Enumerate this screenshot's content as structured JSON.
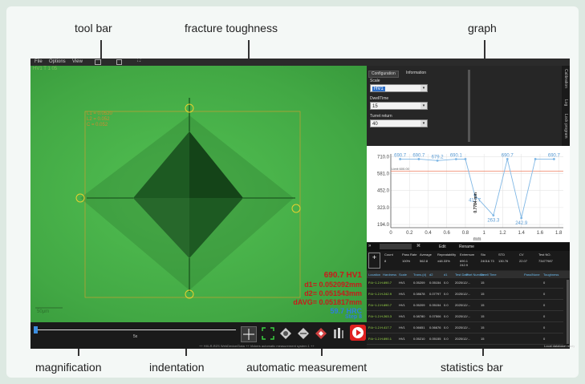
{
  "callouts": {
    "tool_bar": "tool bar",
    "fracture_toughness": "fracture toughness",
    "graph": "graph",
    "magnification": "magnification",
    "indentation": "indentation",
    "automatic_measurement": "automatic measurement",
    "statistics_bar": "statistics bar"
  },
  "menu": {
    "file": "File",
    "options": "Options",
    "view": "View"
  },
  "viewer": {
    "top_left_note": "HV1 T 1 05",
    "overlay_l1": "L1 = 0.0520",
    "overlay_l2": "L2 = 0.052",
    "overlay_l3": "C = 0.052",
    "scale_label": "50μm",
    "result_hv": "690.7 HV1",
    "result_d1": "d1= 0.052092mm",
    "result_d2": "d2= 0.051543mm",
    "result_davg": "dAVG= 0.051817mm",
    "result_hrc": "59.7 HRC",
    "result_step": "Step 8",
    "zoom_label": "5x",
    "status": "++ HXLR-RZS WebDevice/Data ++ Vickers automatic measurement system 1 ++"
  },
  "panel": {
    "tab_config": "Configuration",
    "tab_info": "Information",
    "scale_label": "Scale",
    "scale_value": "HV1",
    "dwell_label": "DwellTime",
    "dwell_value": "15",
    "turret_label": "Turret return",
    "turret_value": "40",
    "side_labels": [
      "Calibration",
      "Log",
      "Lock program"
    ]
  },
  "chart_data": {
    "type": "line",
    "x": [
      0.1,
      0.3,
      0.5,
      0.7,
      0.8,
      0.9,
      1.1,
      1.25,
      1.4,
      1.55,
      1.75
    ],
    "values": [
      690.7,
      690.7,
      679.2,
      690.1,
      690.7,
      417.7,
      263.3,
      690.7,
      242.9,
      690.7,
      690.7
    ],
    "point_labels": [
      "690.7",
      "690.7",
      "679.2",
      "690.1",
      "",
      "417.7",
      "263.3",
      "690.7",
      "242.9",
      "",
      "690.7"
    ],
    "yticks": [
      "710.0",
      "581.0",
      "452.0",
      "323.0",
      "194.0"
    ],
    "ytick_values": [
      710,
      581,
      452,
      323,
      194
    ],
    "xticks": [
      "0",
      "0.2",
      "0.4",
      "0.6",
      "0.8",
      "1",
      "1.2",
      "1.4",
      "1.6",
      "1.8"
    ],
    "xtick_values": [
      0,
      0.2,
      0.4,
      0.6,
      0.8,
      1.0,
      1.2,
      1.4,
      1.6,
      1.8
    ],
    "xlabel": "mm",
    "ylabel": "",
    "limit_label": "Limit 600.00",
    "limit_value": 600,
    "annotation": "0.7784 mm",
    "xlim": [
      0,
      1.85
    ],
    "ylim": [
      170,
      730
    ],
    "line_color": "#7fb7e5",
    "limit_color": "#f08060"
  },
  "tablebar": {
    "col1": "",
    "col2": "Edit",
    "col3": "Rename"
  },
  "stats": {
    "headers": [
      "Count",
      "Pass Rate",
      "Average",
      "Repeatability",
      "Extremum",
      "Sto",
      "STD",
      "CV",
      "Test NO."
    ],
    "values": [
      "8",
      "100%",
      "562.8",
      "±48.33%",
      "690.1\n242.9",
      "24016.73",
      "130.76",
      "22.07",
      "73477987"
    ]
  },
  "table": {
    "headers": [
      "Location",
      "Hardness",
      "Scale",
      "Trans.(d)",
      "d2",
      "d1",
      "Test Date",
      "Part Number",
      "Dwell Time",
      "Pass/None",
      "Toughness"
    ],
    "rows": [
      [
        "P.A~1.2.H.690.7",
        "HV1",
        "0.05209",
        "0.05154",
        "0.0",
        "2025/12/...",
        "15",
        "0"
      ],
      [
        "P.A~1.2.H.242.9",
        "HV1",
        "0.08678",
        "0.07797",
        "0.0",
        "2025/12/...",
        "15",
        "0"
      ],
      [
        "P.A~1.2.H.690.7",
        "HV1",
        "0.05209",
        "0.05154",
        "0.0",
        "2025/12/...",
        "15",
        "0"
      ],
      [
        "P.A~1.2.H.263.3",
        "HV1",
        "0.08780",
        "0.07506",
        "0.0",
        "2025/12/...",
        "15",
        "0"
      ],
      [
        "P.A~1.2.H.417.7",
        "HV1",
        "0.06651",
        "0.06676",
        "0.0",
        "2025/12/...",
        "15",
        "0"
      ],
      [
        "P.A~1.2.H.690.1",
        "HV1",
        "0.05210",
        "0.05155",
        "0.0",
        "2025/12/...",
        "15",
        "0"
      ]
    ]
  },
  "footer_right": "Local database ready"
}
